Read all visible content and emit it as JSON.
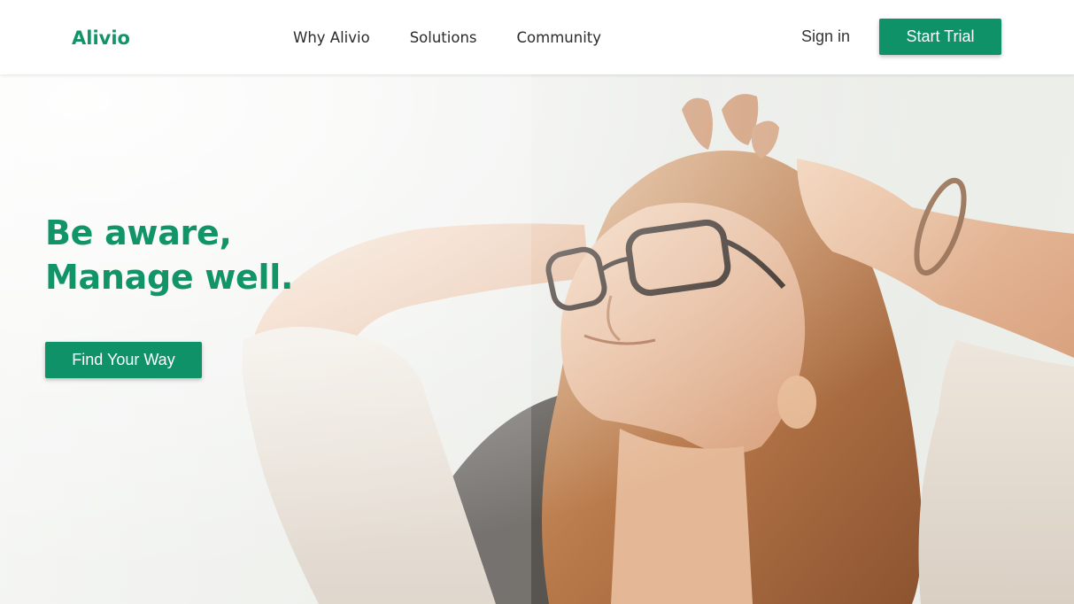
{
  "header": {
    "logo": "Alivio",
    "nav": [
      {
        "label": "Why Alivio"
      },
      {
        "label": "Solutions"
      },
      {
        "label": "Community"
      }
    ],
    "sign_in": "Sign in",
    "start_trial": "Start Trial"
  },
  "hero": {
    "headline": "Be aware, Manage well.",
    "cta": "Find Your Way",
    "image": "woman-with-glasses-relaxing-in-sunlight"
  },
  "colors": {
    "brand_green": "#0f9268",
    "text_dark": "#2b2b2b",
    "header_bg": "#ffffff"
  }
}
